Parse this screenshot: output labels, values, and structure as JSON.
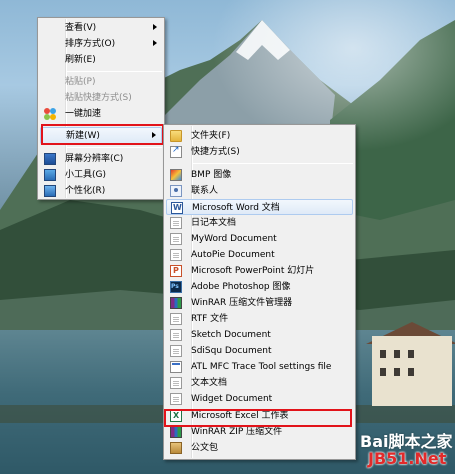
{
  "context_menu": {
    "items": [
      {
        "label": "查看(V)",
        "has_submenu": true,
        "disabled": false
      },
      {
        "label": "排序方式(O)",
        "has_submenu": true,
        "disabled": false
      },
      {
        "label": "刷新(E)",
        "has_submenu": false,
        "disabled": false
      },
      {
        "label": "粘贴(P)",
        "has_submenu": false,
        "disabled": true
      },
      {
        "label": "粘贴快捷方式(S)",
        "has_submenu": false,
        "disabled": true
      },
      {
        "label": "一键加速",
        "has_submenu": false,
        "disabled": false,
        "icon": "speedup-icon"
      },
      {
        "label": "新建(W)",
        "has_submenu": true,
        "disabled": false,
        "highlighted": true
      },
      {
        "label": "屏幕分辨率(C)",
        "has_submenu": false,
        "disabled": false,
        "icon": "screen-resolution-icon"
      },
      {
        "label": "小工具(G)",
        "has_submenu": false,
        "disabled": false,
        "icon": "gadgets-icon"
      },
      {
        "label": "个性化(R)",
        "has_submenu": false,
        "disabled": false,
        "icon": "personalize-icon"
      }
    ]
  },
  "new_submenu": {
    "items": [
      {
        "label": "文件夹(F)",
        "icon": "folder-icon"
      },
      {
        "label": "快捷方式(S)",
        "icon": "shortcut-icon"
      },
      {
        "label": "BMP 图像",
        "icon": "bmp-image-icon"
      },
      {
        "label": "联系人",
        "icon": "contact-icon"
      },
      {
        "label": "Microsoft Word 文档",
        "icon": "word-document-icon",
        "hovered": true
      },
      {
        "label": "日记本文档",
        "icon": "journal-document-icon"
      },
      {
        "label": "MyWord Document",
        "icon": "myword-document-icon"
      },
      {
        "label": "AutoPie Document",
        "icon": "autopie-document-icon"
      },
      {
        "label": "Microsoft PowerPoint 幻灯片",
        "icon": "powerpoint-slide-icon"
      },
      {
        "label": "Adobe Photoshop 图像",
        "icon": "photoshop-image-icon"
      },
      {
        "label": "WinRAR 压缩文件管理器",
        "icon": "winrar-archive-icon"
      },
      {
        "label": "RTF 文件",
        "icon": "rtf-file-icon"
      },
      {
        "label": "Sketch Document",
        "icon": "sketch-document-icon"
      },
      {
        "label": "SdiSqu Document",
        "icon": "sdisqu-document-icon"
      },
      {
        "label": "ATL MFC Trace Tool settings file",
        "icon": "trace-tool-settings-icon"
      },
      {
        "label": "文本文档",
        "icon": "text-document-icon"
      },
      {
        "label": "Widget Document",
        "icon": "widget-document-icon"
      },
      {
        "label": "Microsoft Excel 工作表",
        "icon": "excel-worksheet-icon",
        "highlighted": true
      },
      {
        "label": "WinRAR ZIP 压缩文件",
        "icon": "winrar-zip-icon"
      },
      {
        "label": "公文包",
        "icon": "briefcase-icon"
      }
    ]
  },
  "watermark": {
    "line1_prefix": "Bai",
    "line1_cn": "脚本之家",
    "line2": "JB51.Net"
  },
  "colors": {
    "highlight_red": "#e2131a",
    "menu_bg": "#f0f0f0"
  }
}
